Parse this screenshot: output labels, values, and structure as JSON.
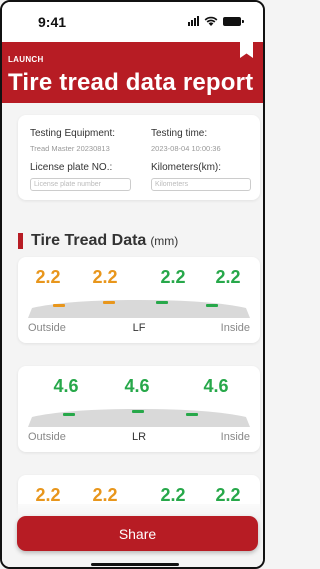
{
  "status_bar": {
    "time": "9:41"
  },
  "header": {
    "brand": "LAUNCH",
    "title": "Tire tread data report"
  },
  "info": {
    "equipment_label": "Testing Equipment:",
    "equipment_value": "Tread Master 20230813",
    "time_label": "Testing time:",
    "time_value": "2023-08-04 10:00:36",
    "plate_label": "License plate NO.:",
    "plate_placeholder": "License plate number",
    "km_label": "Kilometers(km):",
    "km_placeholder": "Kilometers"
  },
  "section": {
    "title": "Tire Tread Data",
    "unit": "(mm)"
  },
  "colors": {
    "brand": "#b71c24",
    "warn": "#e8961c",
    "ok": "#27a84a"
  },
  "tires": [
    {
      "position": "LF",
      "outside_label": "Outside",
      "inside_label": "Inside",
      "values": [
        {
          "value": "2.2",
          "status": "warn"
        },
        {
          "value": "2.2",
          "status": "warn"
        },
        {
          "value": "2.2",
          "status": "ok"
        },
        {
          "value": "2.2",
          "status": "ok"
        }
      ]
    },
    {
      "position": "LR",
      "outside_label": "Outside",
      "inside_label": "Inside",
      "values": [
        {
          "value": "4.6",
          "status": "ok"
        },
        {
          "value": "4.6",
          "status": "ok"
        },
        {
          "value": "4.6",
          "status": "ok"
        }
      ]
    },
    {
      "position": "",
      "outside_label": "",
      "inside_label": "",
      "values": [
        {
          "value": "2.2",
          "status": "warn"
        },
        {
          "value": "2.2",
          "status": "warn"
        },
        {
          "value": "2.2",
          "status": "ok"
        },
        {
          "value": "2.2",
          "status": "ok"
        }
      ]
    }
  ],
  "share": {
    "label": "Share"
  }
}
